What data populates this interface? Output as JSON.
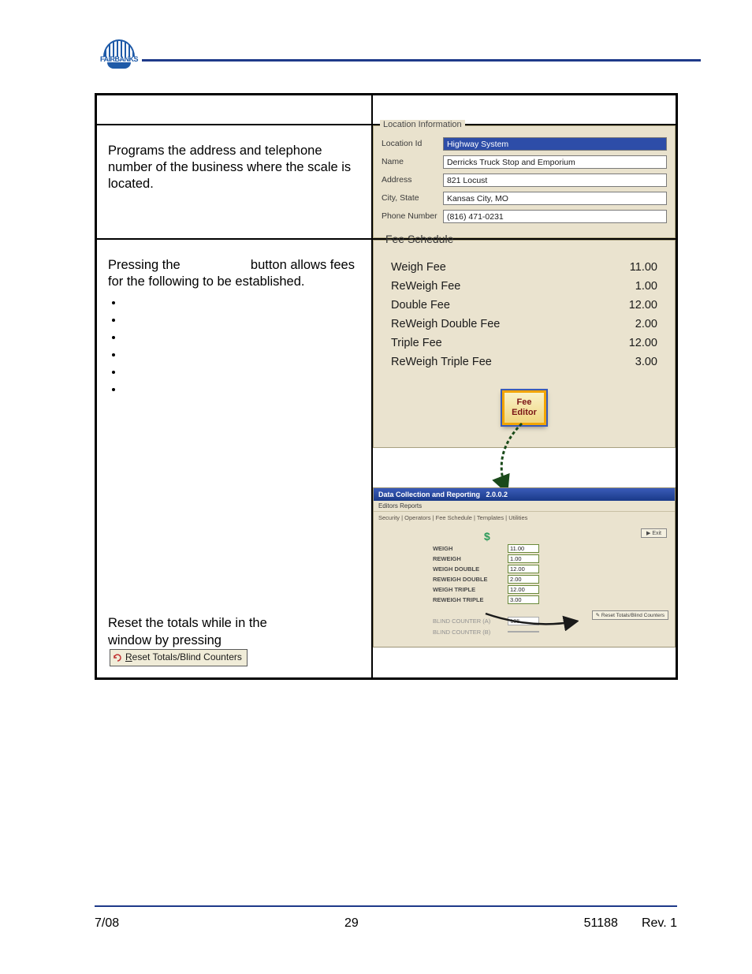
{
  "logo_text": "FAIRBANKS",
  "row1": {
    "desc": "Programs the address and telephone number of the business where the scale is located.",
    "panel_title": "Location Information",
    "fields": [
      {
        "label": "Location Id",
        "value": "Highway System",
        "highlight": true
      },
      {
        "label": "Name",
        "value": "Derricks Truck Stop and Emporium"
      },
      {
        "label": "Address",
        "value": "821 Locust"
      },
      {
        "label": "City, State",
        "value": "Kansas City, MO"
      },
      {
        "label": "Phone Number",
        "value": "(816) 471-0231"
      }
    ]
  },
  "row2": {
    "desc_pre": "Pressing the",
    "desc_post": "button allows fees for the following to be established.",
    "panel_title": "Fee Schedule",
    "fees": [
      {
        "label": "Weigh Fee",
        "value": "11.00"
      },
      {
        "label": "ReWeigh Fee",
        "value": "1.00"
      },
      {
        "label": "Double Fee",
        "value": "12.00"
      },
      {
        "label": "ReWeigh Double Fee",
        "value": "2.00"
      },
      {
        "label": "Triple Fee",
        "value": "12.00"
      },
      {
        "label": "ReWeigh Triple Fee",
        "value": "3.00"
      }
    ],
    "fee_editor_label": "Fee Editor",
    "inner": {
      "title": "Data Collection and Reporting",
      "version": "2.0.0.2",
      "menu": "Editors   Reports",
      "tabs": "Security |  Operators |  Fee Schedule |  Templates |  Utilities",
      "exit": "Exit",
      "rows": [
        {
          "label": "WEIGH",
          "value": "11.00"
        },
        {
          "label": "REWEIGH",
          "value": "1.00"
        },
        {
          "label": "WEIGH DOUBLE",
          "value": "12.00"
        },
        {
          "label": "REWEIGH DOUBLE",
          "value": "2.00"
        },
        {
          "label": "WEIGH TRIPLE",
          "value": "12.00"
        },
        {
          "label": "REWEIGH TRIPLE",
          "value": "3.00"
        }
      ],
      "blind_a": {
        "label": "BLIND COUNTER (A)",
        "value": "105"
      },
      "blind_b": {
        "label": "BLIND COUNTER (B)",
        "value": ""
      },
      "reset_mini": "Reset Totals/Blind Counters"
    }
  },
  "row3": {
    "desc_pre": "Reset the totals while in the",
    "desc_mid": "window by pressing",
    "reset_btn": "Reset Totals/Blind Counters"
  },
  "footer": {
    "left": "7/08",
    "center": "29",
    "right1": "51188",
    "right2": "Rev. 1"
  }
}
